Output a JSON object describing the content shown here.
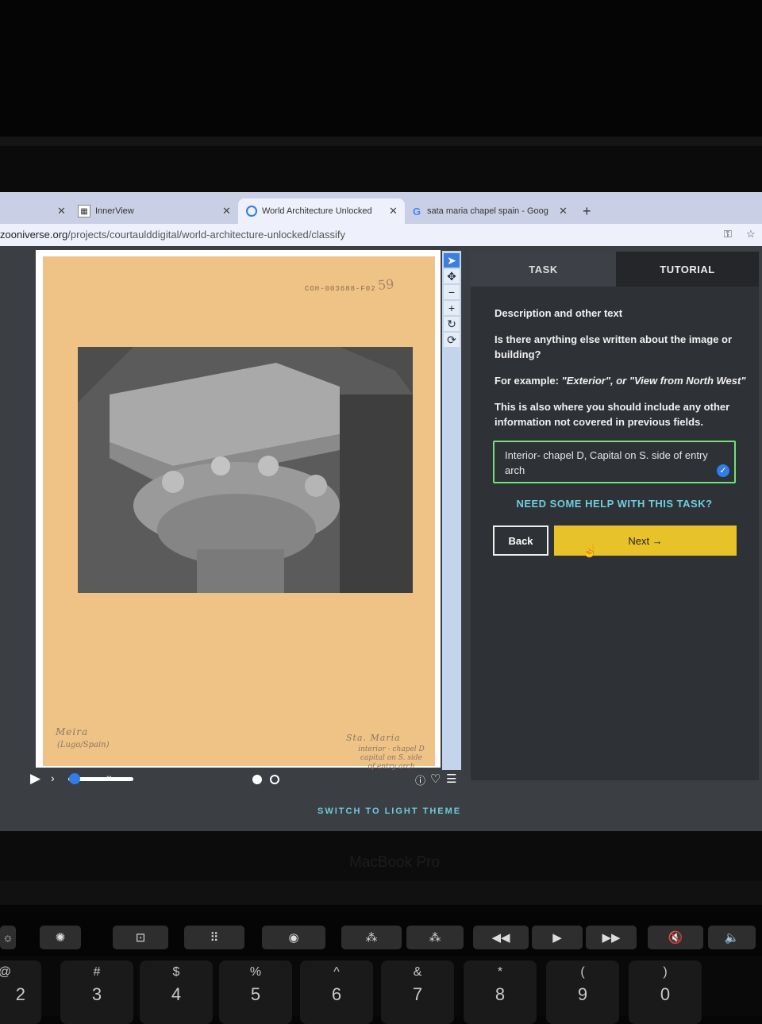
{
  "browser": {
    "tabs": [
      {
        "label": "",
        "icon": "close-icon"
      },
      {
        "label": "InnerView",
        "icon": "innerview-icon"
      },
      {
        "label": "World Architecture Unlocked",
        "icon": "zooniverse-icon"
      },
      {
        "label": "sata maria chapel spain - Goog",
        "icon": "google-icon"
      }
    ],
    "new_tab_label": "+",
    "url_domain": "zooniverse.org",
    "url_path": "/projects/courtaulddigital/world-architecture-unlocked/classify"
  },
  "sheet": {
    "stamp_code": "COH-003688-F02",
    "stamp_number": "59",
    "left_caption_1": "Meira",
    "left_caption_2": "(Lugo/Spain)",
    "right_caption_1": "Sta. Maria",
    "right_caption_2": "interior - chapel D",
    "right_caption_3": "capital on S. side",
    "right_caption_4": "of entry arch"
  },
  "viewer_controls": {
    "play_label": "▶",
    "step_back_label": "›",
    "step_fwd_label": "»",
    "slider_value": 0.1
  },
  "panel": {
    "tab_task": "TASK",
    "tab_tutorial": "TUTORIAL",
    "heading": "Description and other text",
    "question": "Is there anything else written about the image or building?",
    "example_prefix": "For example: ",
    "example_text": "\"Exterior\", or \"View from North West\"",
    "info": "This is also where you should include any other information not covered in previous fields.",
    "answer_value": "Interior- chapel D, Capital on S. side of entry arch",
    "help_link": "NEED SOME HELP WITH THIS TASK?",
    "back_label": "Back",
    "next_label": "Next →"
  },
  "theme_link": "SWITCH TO LIGHT THEME",
  "laptop": {
    "brand": "MacBook Pro",
    "keys": [
      {
        "top": "@",
        "bot": "2"
      },
      {
        "top": "#",
        "bot": "3"
      },
      {
        "top": "$",
        "bot": "4"
      },
      {
        "top": "%",
        "bot": "5"
      },
      {
        "top": "^",
        "bot": "6"
      },
      {
        "top": "&",
        "bot": "7"
      },
      {
        "top": "*",
        "bot": "8"
      },
      {
        "top": "(",
        "bot": "9"
      },
      {
        "top": ")",
        "bot": "0"
      }
    ]
  },
  "colors": {
    "accent_next": "#e8c229",
    "link_teal": "#6ecfdc",
    "answer_border": "#6fe27a",
    "tool_selected": "#3d7fe0"
  }
}
